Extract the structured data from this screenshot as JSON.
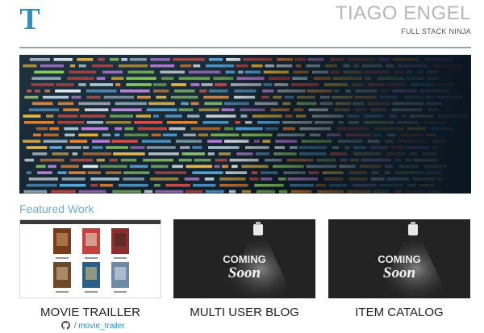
{
  "header": {
    "logo_letter": "T",
    "name": "TIAGO ENGEL",
    "role": "FULL STACK NINJA"
  },
  "hero": {
    "image": "code-screen-photo"
  },
  "featured": {
    "heading": "Featured Work",
    "projects": [
      {
        "title": "MOVIE TRAILLER",
        "thumbnail": "movie-poster-grid",
        "repo_separator": "/",
        "repo_link": "movie_trailer"
      },
      {
        "title": "MULTI USER BLOG",
        "thumbnail": "coming-soon-spotlight",
        "thumb_text_top": "COMING",
        "thumb_text_bottom": "Soon"
      },
      {
        "title": "ITEM CATALOG",
        "thumbnail": "coming-soon-spotlight",
        "thumb_text_top": "COMING",
        "thumb_text_bottom": "Soon"
      }
    ]
  },
  "colors": {
    "name_gray": "#b4b6b7",
    "accent_blue": "#6ab0ce",
    "link_blue": "#2d8fc8",
    "card_dark": "#232323"
  }
}
